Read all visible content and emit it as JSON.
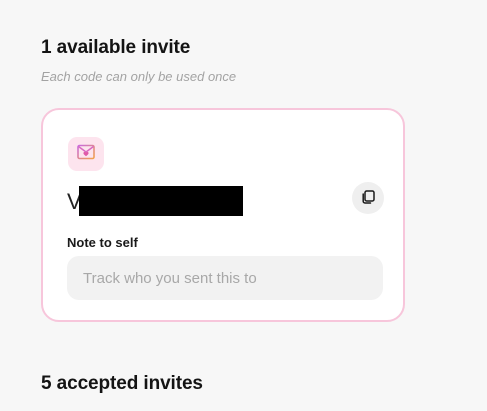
{
  "available": {
    "title": "1 available invite",
    "subtitle": "Each code can only be used once"
  },
  "invite_card": {
    "icon": "envelope-heart-icon",
    "code_visible_prefix": "V",
    "code_redacted": true,
    "copy_icon": "copy-icon",
    "note_label": "Note to self",
    "note_value": "",
    "note_placeholder": "Track who you sent this to"
  },
  "accepted": {
    "title": "5 accepted invites"
  },
  "colors": {
    "page_background": "#f7f7f7",
    "card_border": "#f7c6db",
    "badge_background": "#fde4ee",
    "icon_accent": "#d96bc2",
    "icon_accent_secondary": "#f2a24b",
    "input_background": "#f2f2f2"
  }
}
